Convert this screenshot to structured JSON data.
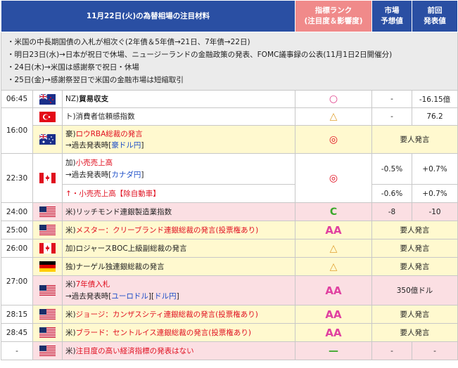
{
  "header": {
    "title": "11月22日(火)の為替相場の注目材料",
    "rank_line1": "指標ランク",
    "rank_line2": "(注目度＆影響度)",
    "market_line1": "市場",
    "market_line2": "予想値",
    "prev_line1": "前回",
    "prev_line2": "発表値"
  },
  "notes": [
    "・米国の中長期国債の入札が相次ぐ(2年債＆5年債→21日、7年債→22日)",
    "・明日23日(水)→日本が祝日で休場、ニュージーランドの金融政策の発表、FOMC議事録の公表(11月1日2日開催分)",
    "・24日(木)→米国は感謝祭で祝日・休場",
    "・25日(金)→感謝祭翌日で米国の金融市場は短縮取引"
  ],
  "rows": {
    "r1": {
      "time": "06:45",
      "country": "NZ)",
      "name": "貿易収支",
      "rank": "○",
      "forecast": "-",
      "prev": "-16.15億"
    },
    "r2": {
      "country": "ト)",
      "name": "消費者信頼感指数",
      "rank": "△",
      "forecast": "-",
      "prev": "76.2"
    },
    "r3": {
      "time": "16:00",
      "country": "豪)",
      "name": "ロウRBA総裁の発言",
      "sub_prefix": "→過去発表時[",
      "sub_link": "豪ドル円",
      "sub_suffix": "]",
      "rank": "◎",
      "merged": "要人発言"
    },
    "r4": {
      "time": "22:30",
      "country": "加)",
      "name": "小売売上高",
      "sub_prefix": "→過去発表時[",
      "sub_link": "カナダ円",
      "sub_suffix": "]",
      "rank": "◎",
      "forecast": "-0.5%",
      "prev": "+0.7%"
    },
    "r5": {
      "name": "↑・小売売上高【除自動車】",
      "forecast": "-0.6%",
      "prev": "+0.7%"
    },
    "r6": {
      "time": "24:00",
      "country": "米)",
      "name": "リッチモンド連銀製造業指数",
      "rank": "C",
      "forecast": "-8",
      "prev": "-10"
    },
    "r7": {
      "time": "25:00",
      "country": "米)",
      "name": "メスター：クリーブランド連銀総裁の発言(投票権あり)",
      "rank": "AA",
      "merged": "要人発言"
    },
    "r8": {
      "time": "26:00",
      "country": "加)",
      "name": "ロジャースBOC上級副総裁の発言",
      "rank": "△",
      "merged": "要人発言"
    },
    "r9": {
      "country": "独)",
      "name": "ナーゲル独連銀総裁の発言",
      "rank": "△",
      "merged": "要人発言"
    },
    "r10": {
      "time": "27:00",
      "country": "米)",
      "name": "7年債入札",
      "sub_prefix": "→過去発表時[",
      "sub_link1": "ユーロドル",
      "sub_mid": "][",
      "sub_link2": "ドル円",
      "sub_suffix": "]",
      "rank": "AA",
      "merged": "350億ドル"
    },
    "r11": {
      "time": "28:15",
      "country": "米)",
      "name": "ジョージ：カンザスシティ連銀総裁の発言(投票権あり)",
      "rank": "AA",
      "merged": "要人発言"
    },
    "r12": {
      "time": "28:45",
      "country": "米)",
      "name": "ブラード：セントルイス連銀総裁の発言(投票権あり)",
      "rank": "AA",
      "merged": "要人発言"
    },
    "r13": {
      "time": "-",
      "country": "米)",
      "name": "注目度の高い経済指標の発表はない",
      "rank": "—",
      "forecast": "-",
      "prev": "-"
    }
  },
  "colors": {
    "header_blue": "#2a4fa3",
    "header_pink": "#f08a8a",
    "yellow_row": "#fff9cf",
    "pink_row": "#fbdfe3"
  }
}
